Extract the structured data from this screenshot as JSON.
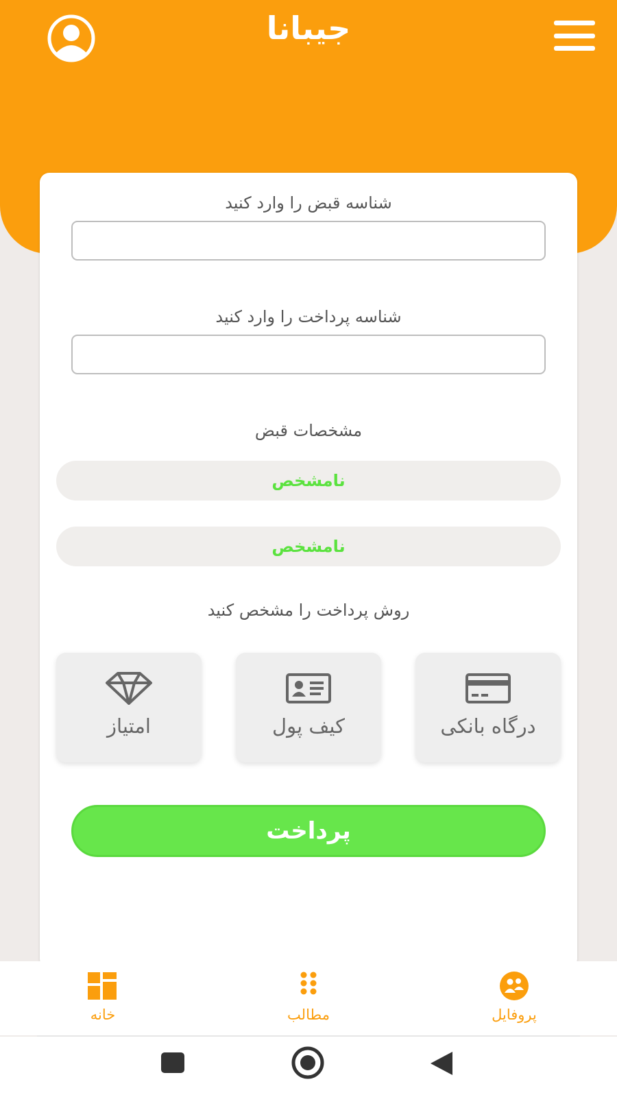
{
  "header": {
    "title": "جیبانا"
  },
  "form": {
    "bill_id_label": "شناسه قبض را وارد کنید",
    "bill_id_value": "",
    "payment_id_label": "شناسه پرداخت را وارد کنید",
    "payment_id_value": "",
    "bill_details_label": "مشخصات قبض",
    "bill_details": [
      "نامشخص",
      "نامشخص"
    ],
    "payment_method_label": "روش پرداخت را مشخص کنید",
    "payment_methods": [
      {
        "label": "درگاه بانکی",
        "icon": "credit-card-icon"
      },
      {
        "label": "کیف پول",
        "icon": "id-card-icon"
      },
      {
        "label": "امتیاز",
        "icon": "diamond-icon"
      }
    ],
    "pay_button": "پرداخت"
  },
  "bottom_nav": [
    {
      "label": "پروفایل",
      "icon": "profile-icon"
    },
    {
      "label": "مطالب",
      "icon": "dots-grid-icon"
    },
    {
      "label": "خانه",
      "icon": "dashboard-icon"
    }
  ],
  "colors": {
    "brand": "#fb9e0d",
    "accent_green": "#67e64b",
    "detail_text": "#5be23f",
    "background": "#efebe9"
  }
}
